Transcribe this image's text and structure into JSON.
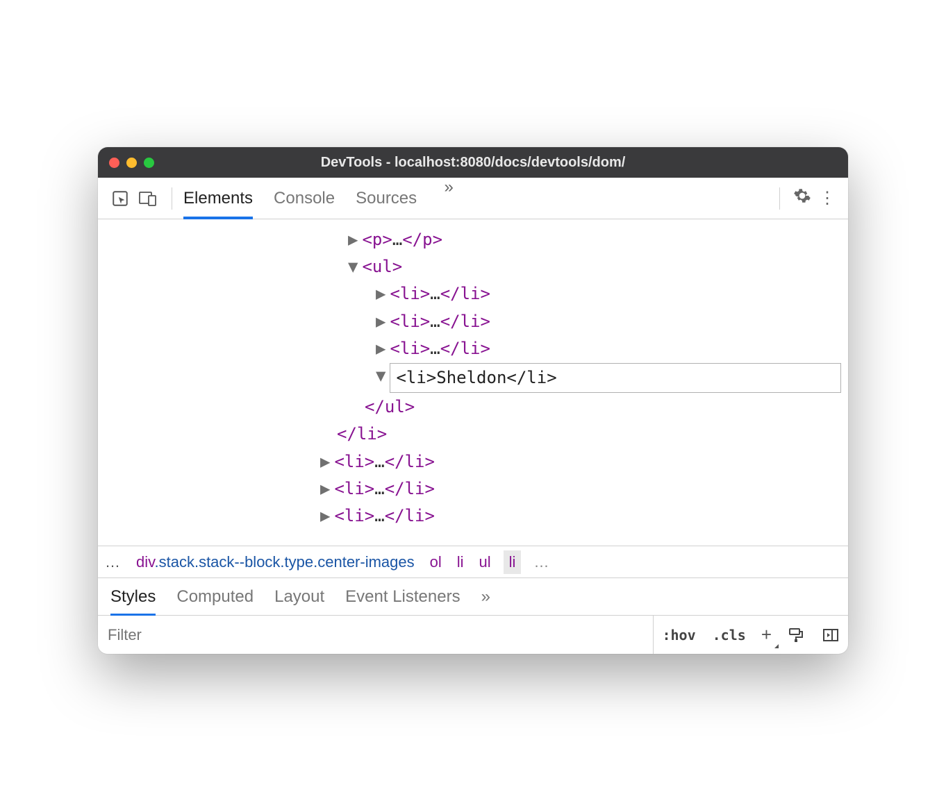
{
  "window": {
    "title": "DevTools - localhost:8080/docs/devtools/dom/"
  },
  "toolbar": {
    "tabs": {
      "elements": "Elements",
      "console": "Console",
      "sources": "Sources"
    }
  },
  "dom": {
    "p_line": {
      "open": "<p>",
      "ell": "…",
      "close": "</p>"
    },
    "ul_open": "<ul>",
    "ul_close": "</ul>",
    "li_open": "<li>",
    "li_close": "</li>",
    "li_ell": "…",
    "edit_value": "<li>Sheldon</li>",
    "outer_li_close": "</li>"
  },
  "breadcrumb": {
    "leading": "…",
    "div": {
      "tag": "div",
      "cls": ".stack.stack--block.type.center-images"
    },
    "ol": "ol",
    "li1": "li",
    "ul": "ul",
    "li2": "li",
    "trailing": "…"
  },
  "styles": {
    "tabs": {
      "styles": "Styles",
      "computed": "Computed",
      "layout": "Layout",
      "event_listeners": "Event Listeners"
    },
    "filter_placeholder": "Filter",
    "hov": ":hov",
    "cls": ".cls",
    "plus": "+"
  }
}
